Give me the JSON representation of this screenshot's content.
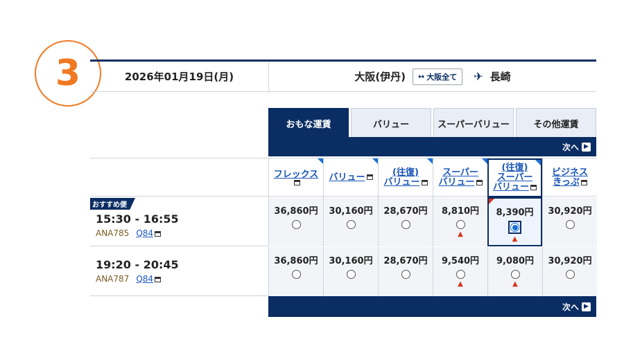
{
  "step": "3",
  "header": {
    "date": "2026年01月19日(月)",
    "origin": "大阪(伊丹)",
    "switch_label": "大阪全て",
    "destination": "長崎"
  },
  "tabs": [
    "おもな運賃",
    "バリュー",
    "スーパーバリュー",
    "その他運賃"
  ],
  "nav": {
    "next_label": "次へ"
  },
  "columns": [
    {
      "line1": "フレックス",
      "line2": "",
      "line3": ""
    },
    {
      "line1": "バリュー",
      "line2": "",
      "line3": ""
    },
    {
      "line1": "(往復)",
      "line2": "バリュー",
      "line3": ""
    },
    {
      "line1": "スーパー",
      "line2": "バリュー",
      "line3": ""
    },
    {
      "line1": "(往復)",
      "line2": "スーパー",
      "line3": "バリュー"
    },
    {
      "line1": "ビジネス",
      "line2": "きっぷ",
      "line3": ""
    }
  ],
  "flights": [
    {
      "badge": "おすすめ便",
      "time": "15:30 - 16:55",
      "flight_no": "ANA785",
      "seat": "Q84",
      "fares": [
        "36,860円",
        "30,160円",
        "28,670円",
        "8,810円",
        "8,390円",
        "30,920円"
      ]
    },
    {
      "badge": "",
      "time": "19:20 - 20:45",
      "flight_no": "ANA787",
      "seat": "Q84",
      "fares": [
        "36,860円",
        "30,160円",
        "28,670円",
        "9,540円",
        "9,080円",
        "30,920円"
      ]
    }
  ],
  "colors": {
    "navy": "#0a2d63",
    "link": "#1a56b8",
    "warning": "#d4351c",
    "step": "#f07a22"
  }
}
